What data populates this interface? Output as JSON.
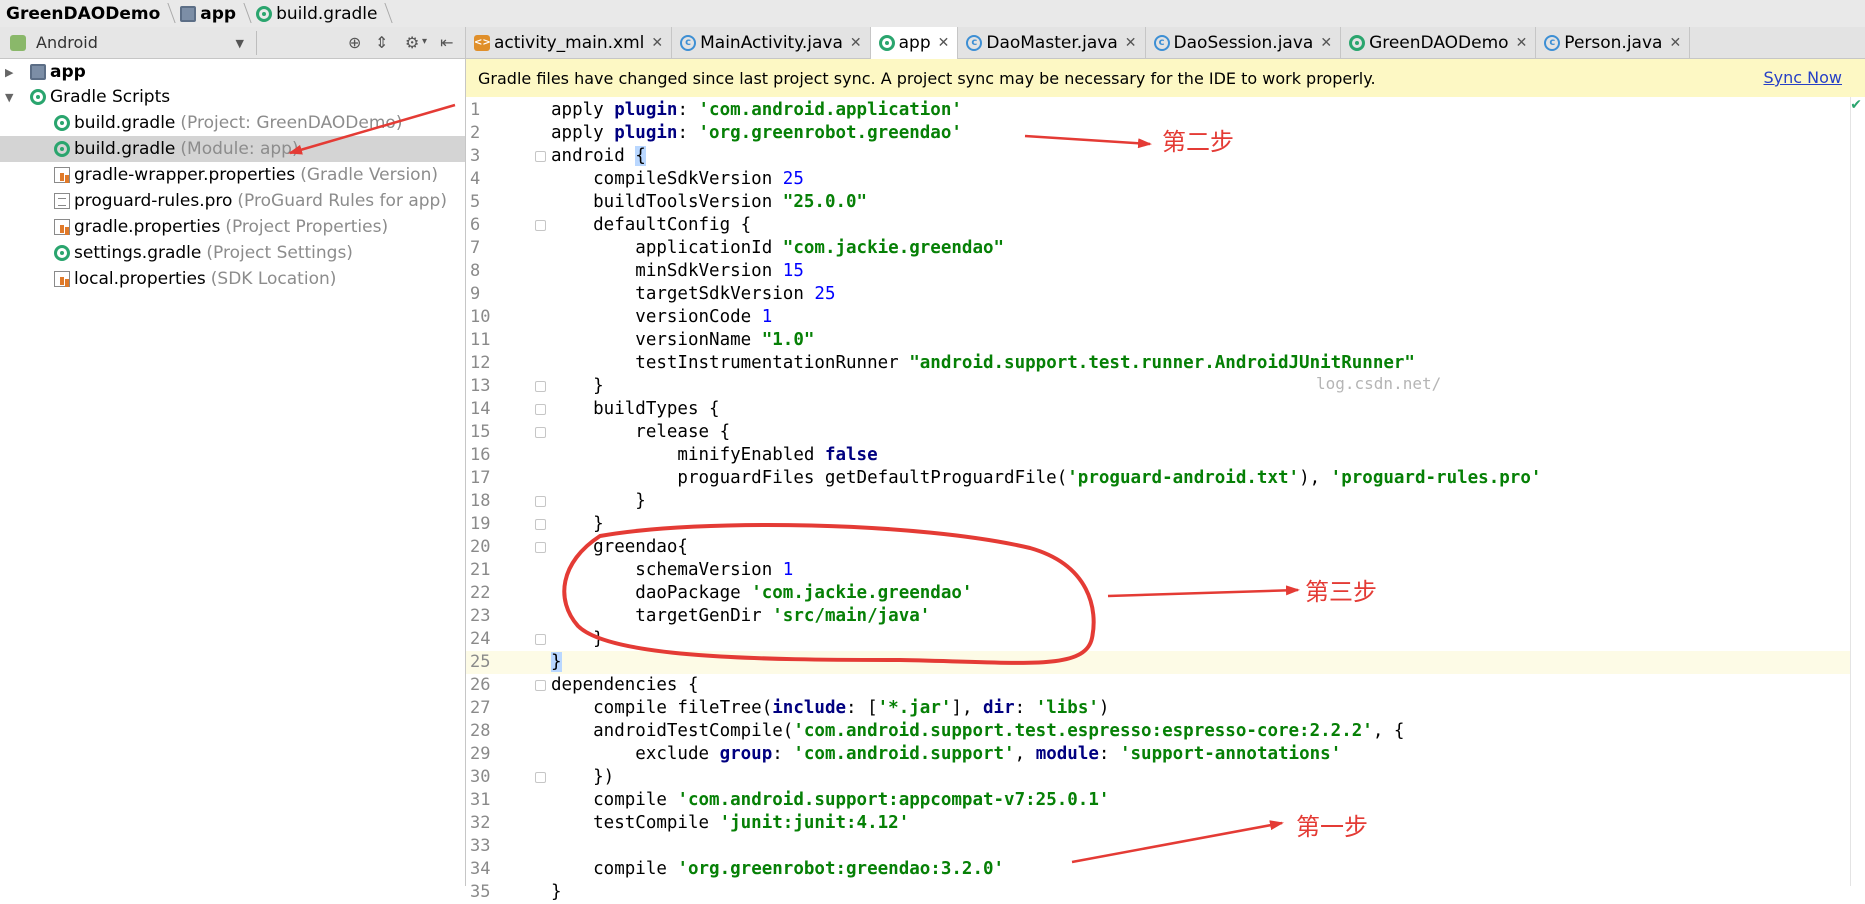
{
  "breadcrumb": [
    "GreenDAODemo",
    "app",
    "build.gradle"
  ],
  "project_view": {
    "selected": "Android",
    "tree": [
      {
        "label": "app",
        "hint": "",
        "icon": "module-folder-icon"
      },
      {
        "label": "Gradle Scripts",
        "hint": "",
        "icon": "gradle-icon"
      },
      {
        "label": "build.gradle",
        "hint": "(Project: GreenDAODemo)",
        "icon": "gradle-icon"
      },
      {
        "label": "build.gradle",
        "hint": "(Module: app)",
        "icon": "gradle-icon"
      },
      {
        "label": "gradle-wrapper.properties",
        "hint": "(Gradle Version)",
        "icon": "properties-file-icon"
      },
      {
        "label": "proguard-rules.pro",
        "hint": "(ProGuard Rules for app)",
        "icon": "text-file-icon"
      },
      {
        "label": "gradle.properties",
        "hint": "(Project Properties)",
        "icon": "properties-file-icon"
      },
      {
        "label": "settings.gradle",
        "hint": "(Project Settings)",
        "icon": "gradle-icon"
      },
      {
        "label": "local.properties",
        "hint": "(SDK Location)",
        "icon": "properties-file-icon"
      }
    ]
  },
  "tabs": [
    {
      "label": "activity_main.xml",
      "icon": "xml-file-icon"
    },
    {
      "label": "MainActivity.java",
      "icon": "java-class-icon"
    },
    {
      "label": "app",
      "icon": "gradle-icon"
    },
    {
      "label": "DaoMaster.java",
      "icon": "java-class-icon"
    },
    {
      "label": "DaoSession.java",
      "icon": "java-class-icon"
    },
    {
      "label": "GreenDAODemo",
      "icon": "gradle-icon"
    },
    {
      "label": "Person.java",
      "icon": "java-class-icon"
    }
  ],
  "notification": {
    "message": "Gradle files have changed since last project sync. A project sync may be necessary for the IDE to work properly.",
    "action": "Sync Now"
  },
  "code": {
    "line_numbers": [
      "1",
      "2",
      "3",
      "4",
      "5",
      "6",
      "7",
      "8",
      "9",
      "10",
      "11",
      "12",
      "13",
      "14",
      "15",
      "16",
      "17",
      "18",
      "19",
      "20",
      "21",
      "22",
      "23",
      "24",
      "25",
      "26",
      "27",
      "28",
      "29",
      "30",
      "31",
      "32",
      "33",
      "34",
      "35"
    ],
    "lines": [
      "apply plugin: 'com.android.application'",
      "apply plugin: 'org.greenrobot.greendao'",
      "android {",
      "    compileSdkVersion 25",
      "    buildToolsVersion \"25.0.0\"",
      "    defaultConfig {",
      "        applicationId \"com.jackie.greendao\"",
      "        minSdkVersion 15",
      "        targetSdkVersion 25",
      "        versionCode 1",
      "        versionName \"1.0\"",
      "        testInstrumentationRunner \"android.support.test.runner.AndroidJUnitRunner\"",
      "    }",
      "    buildTypes {",
      "        release {",
      "            minifyEnabled false",
      "            proguardFiles getDefaultProguardFile('proguard-android.txt'), 'proguard-rules.pro'",
      "        }",
      "    }",
      "    greendao{",
      "        schemaVersion 1",
      "        daoPackage 'com.jackie.greendao'",
      "        targetGenDir 'src/main/java'",
      "    }",
      "}",
      "dependencies {",
      "    compile fileTree(include: ['*.jar'], dir: 'libs')",
      "    androidTestCompile('com.android.support.test.espresso:espresso-core:2.2.2', {",
      "        exclude group: 'com.android.support', module: 'support-annotations'",
      "    })",
      "    compile 'com.android.support:appcompat-v7:25.0.1'",
      "    testCompile 'junit:junit:4.12'",
      "",
      "    compile 'org.greenrobot:greendao:3.2.0'",
      "}"
    ],
    "current_line": "25"
  },
  "watermark": "log.csdn.net/",
  "annotations": {
    "step1": "第一步",
    "step2": "第二步",
    "step3": "第三步"
  },
  "colors": {
    "keyword": "#000080",
    "string": "#068006",
    "number": "#0000ff",
    "annotation_red": "#e43b35",
    "banner_bg": "#fdf8c4",
    "link": "#2640c6"
  }
}
